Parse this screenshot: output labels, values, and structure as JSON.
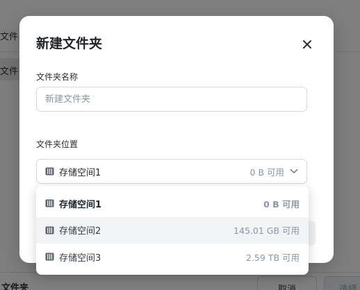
{
  "background": {
    "header_text": "文件",
    "row_text": "文件",
    "footer_text": "文件夹",
    "cancel_label": "取消",
    "select_label": "选择"
  },
  "modal": {
    "title": "新建文件夹",
    "name_label": "文件夹名称",
    "name_value": "",
    "name_placeholder": "新建文件夹",
    "location_label": "文件夹位置",
    "selected": {
      "icon": "storage-icon",
      "name": "存储空间1",
      "available": "0 B 可用"
    }
  },
  "dropdown": {
    "items": [
      {
        "icon": "storage-icon",
        "name": "存储空间1",
        "available": "0 B 可用"
      },
      {
        "icon": "storage-icon",
        "name": "存储空间2",
        "available": "145.01 GB 可用"
      },
      {
        "icon": "storage-icon",
        "name": "存储空间3",
        "available": "2.59 TB 可用"
      }
    ]
  },
  "colors": {
    "overlay": "rgba(0,0,0,0.5)",
    "text_primary": "#1f2329",
    "text_muted": "#8a96a8",
    "hover_bg": "#f2f3f5"
  }
}
